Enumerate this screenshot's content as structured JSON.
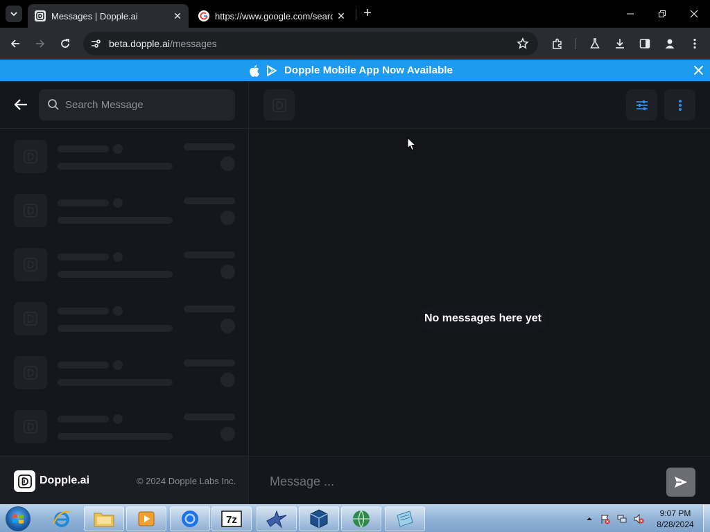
{
  "browser": {
    "tabs": [
      {
        "title": "Messages | Dopple.ai",
        "active": true,
        "favicon": "dopple-favicon"
      },
      {
        "title": "https://www.google.com/search",
        "active": false,
        "favicon": "google-favicon"
      }
    ],
    "address": {
      "host": "beta.dopple.ai",
      "path": "/messages"
    }
  },
  "banner": {
    "text": "Dopple Mobile App Now Available",
    "color": "#1b9af0",
    "icons": [
      "apple-icon",
      "google-play-icon"
    ]
  },
  "sidebar": {
    "search_placeholder": "Search Message",
    "conversations_loading": 6
  },
  "footer": {
    "logo_text": "Dopple.ai",
    "copyright": "© 2024 Dopple Labs Inc."
  },
  "chat": {
    "empty_text": "No messages here yet",
    "composer_placeholder": "Message ...",
    "accent": "#2b8ff0"
  },
  "taskbar": {
    "pinned": [
      "internet-explorer-icon",
      "file-explorer-icon",
      "media-player-icon",
      "chrome-icon",
      "7zip-icon",
      "bird-app-icon",
      "virtualbox-icon",
      "globe-app-icon",
      "notepad-app-icon"
    ],
    "time": "9:07 PM",
    "date": "8/28/2024"
  }
}
